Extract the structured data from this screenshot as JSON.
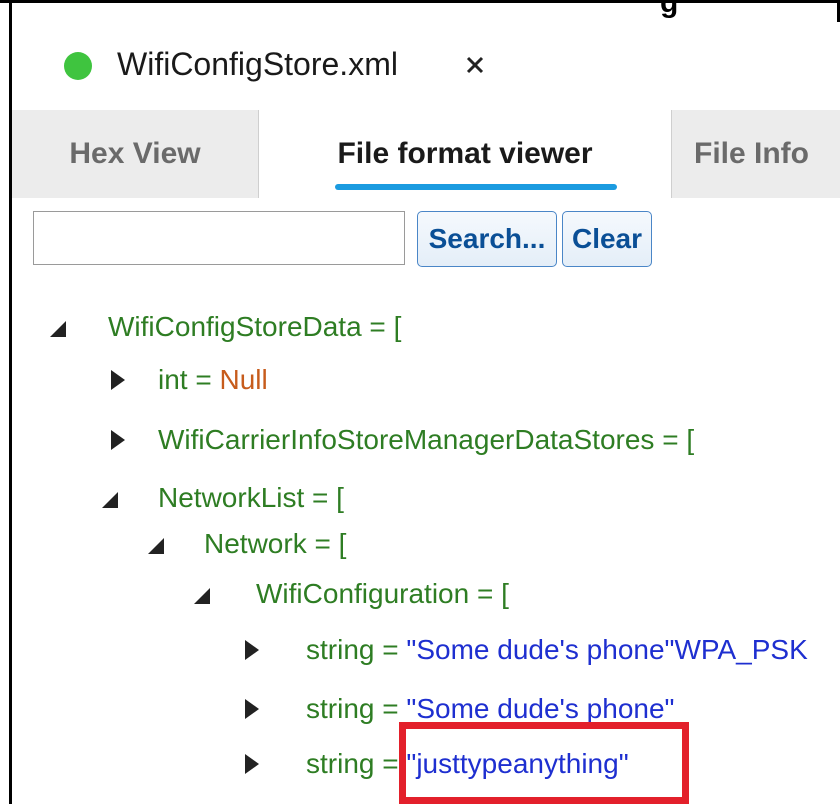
{
  "window": {
    "heading_fragment": "g",
    "file_title": "WifiConfigStore.xml",
    "close_label": "×"
  },
  "tabs": [
    {
      "label": "Hex View",
      "active": false
    },
    {
      "label": "File format viewer",
      "active": true
    },
    {
      "label": "File Info",
      "active": false
    }
  ],
  "search": {
    "value": "",
    "placeholder": "",
    "search_button": "Search...",
    "clear_button": "Clear"
  },
  "tree": [
    {
      "key": "WifiConfigStoreData",
      "op": " = [",
      "value": "",
      "expanded": true
    },
    {
      "key": "int",
      "op": " = ",
      "value": "Null",
      "expanded": false
    },
    {
      "key": "WifiCarrierInfoStoreManagerDataStores",
      "op": " = [",
      "value": "",
      "expanded": false
    },
    {
      "key": "NetworkList",
      "op": " = [",
      "value": "",
      "expanded": true
    },
    {
      "key": "Network",
      "op": " = [",
      "value": "",
      "expanded": true
    },
    {
      "key": "WifiConfiguration",
      "op": " = [",
      "value": "",
      "expanded": true
    },
    {
      "key": "string",
      "op": " = ",
      "value": "\"Some dude's phone\"WPA_PSK",
      "expanded": false
    },
    {
      "key": "string",
      "op": " = ",
      "value": "\"Some dude's phone\"",
      "expanded": false
    },
    {
      "key": "string",
      "op": " = ",
      "value": "\"justtypeanything\"",
      "expanded": false
    }
  ],
  "colors": {
    "status_dot": "#3fc43f",
    "active_tab_underline": "#1b9be0",
    "key_text": "#2e7d23",
    "null_text": "#c75c1c",
    "string_text": "#1e2fd0",
    "highlight_border": "#e3202b"
  },
  "icons": {
    "status": "status-dot-icon",
    "close": "close-icon",
    "expanded": "triangle-expanded-icon",
    "collapsed": "triangle-collapsed-icon"
  }
}
